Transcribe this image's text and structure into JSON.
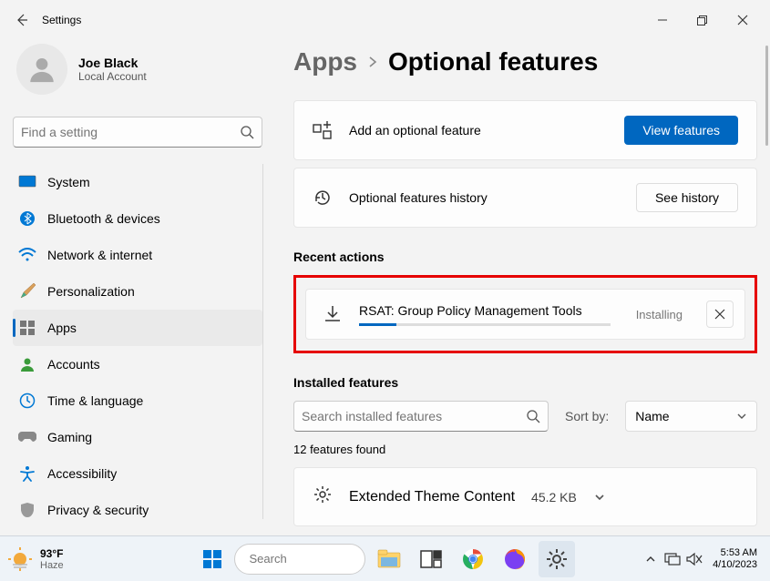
{
  "window": {
    "title": "Settings"
  },
  "user": {
    "name": "Joe Black",
    "account_type": "Local Account"
  },
  "sidebar": {
    "search_placeholder": "Find a setting",
    "items": [
      {
        "label": "System"
      },
      {
        "label": "Bluetooth & devices"
      },
      {
        "label": "Network & internet"
      },
      {
        "label": "Personalization"
      },
      {
        "label": "Apps"
      },
      {
        "label": "Accounts"
      },
      {
        "label": "Time & language"
      },
      {
        "label": "Gaming"
      },
      {
        "label": "Accessibility"
      },
      {
        "label": "Privacy & security"
      }
    ]
  },
  "breadcrumb": {
    "parent": "Apps",
    "current": "Optional features"
  },
  "cards": {
    "add_feature": {
      "label": "Add an optional feature",
      "button": "View features"
    },
    "history": {
      "label": "Optional features history",
      "button": "See history"
    }
  },
  "recent": {
    "heading": "Recent actions",
    "item": {
      "title": "RSAT: Group Policy Management Tools",
      "status": "Installing"
    }
  },
  "installed": {
    "heading": "Installed features",
    "search_placeholder": "Search installed features",
    "sort_label": "Sort by:",
    "sort_value": "Name",
    "count": "12 features found",
    "first": {
      "label": "Extended Theme Content",
      "size": "45.2 KB"
    }
  },
  "taskbar": {
    "weather": {
      "temp": "93°F",
      "condition": "Haze"
    },
    "search_placeholder": "Search",
    "clock": {
      "time": "5:53 AM",
      "date": "4/10/2023"
    }
  }
}
